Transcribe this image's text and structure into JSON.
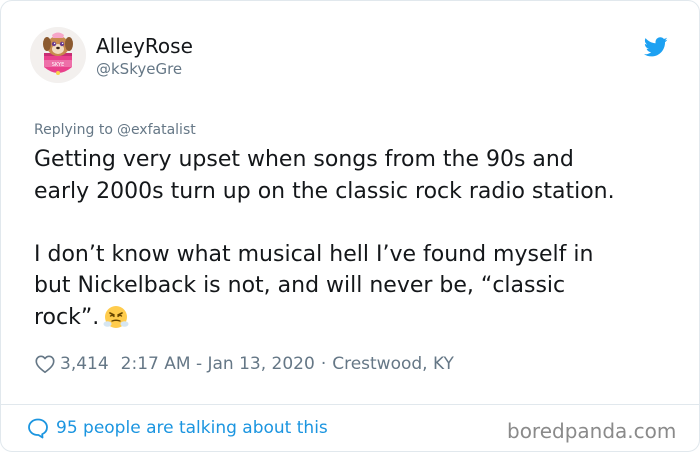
{
  "user": {
    "display_name": "AlleyRose",
    "handle": "@kSkyeGre",
    "avatar_icon": "skye-badge-avatar",
    "avatar_badge_text": "SKYE"
  },
  "reply": {
    "prefix": "Replying to",
    "mention": "@exfatalist"
  },
  "tweet": {
    "lines": [
      "Getting very upset when songs from the 90s and",
      "early 2000s turn up on the classic rock radio station.",
      "I don’t know what musical hell I’ve found myself in",
      "but Nickelback is not, and will never be, “classic",
      "rock”."
    ],
    "emoji": "face-with-steam-from-nose"
  },
  "meta": {
    "likes": "3,414",
    "timestamp": "2:17 AM - Jan 13, 2020",
    "separator": "·",
    "location": "Crestwood, KY"
  },
  "footer": {
    "talking": "95 people are talking about this",
    "watermark": "boredpanda.com"
  },
  "colors": {
    "twitter_blue": "#1da1f2",
    "link_blue": "#1b95e0",
    "muted_gray": "#657786",
    "text": "#14171a"
  }
}
